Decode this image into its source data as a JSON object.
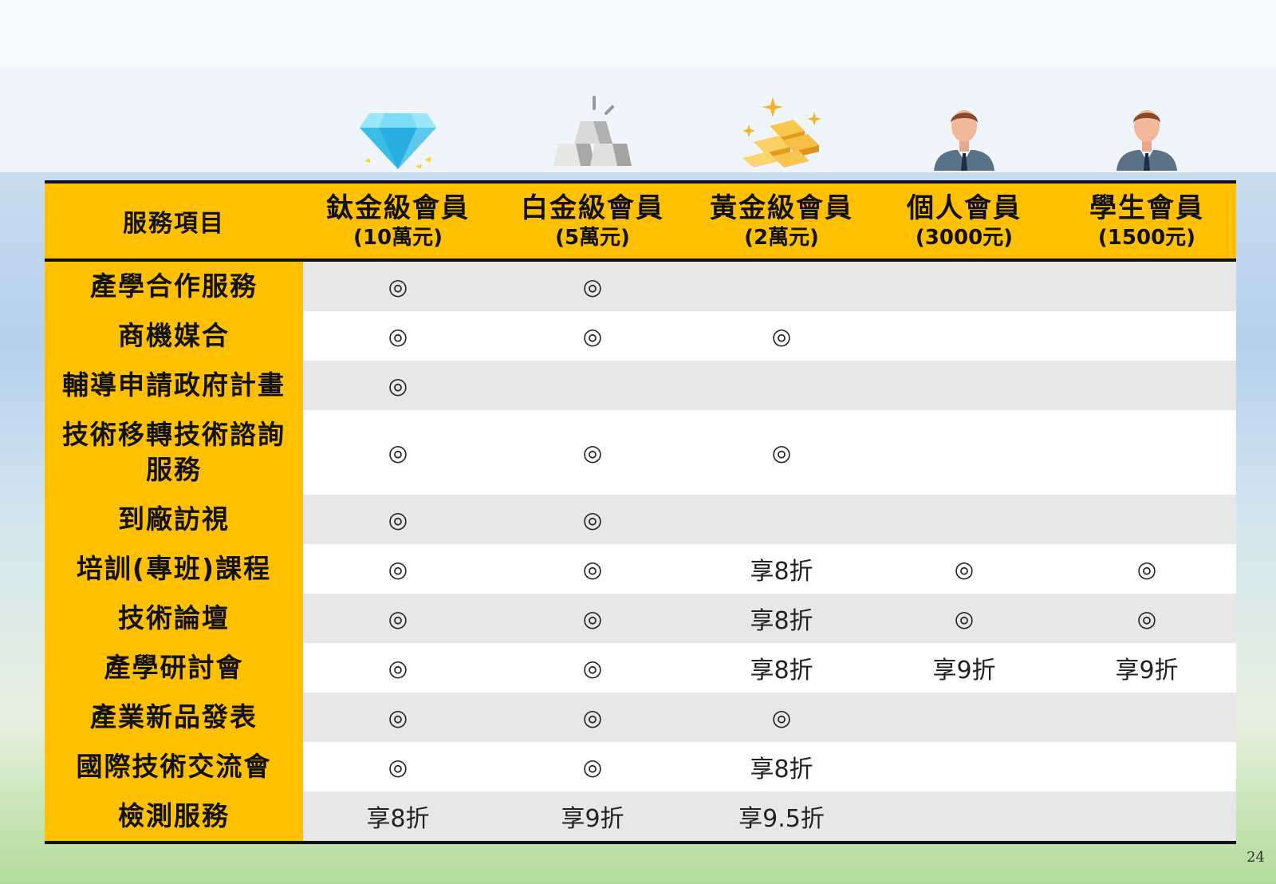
{
  "table": {
    "service_header": "服務項目",
    "tiers": [
      {
        "name": "鈦金級會員",
        "price": "(10萬元)",
        "icon": "diamond-icon"
      },
      {
        "name": "白金級會員",
        "price": "(5萬元)",
        "icon": "silver-bars-icon"
      },
      {
        "name": "黃金級會員",
        "price": "(2萬元)",
        "icon": "gold-bars-icon"
      },
      {
        "name": "個人會員",
        "price": "(3000元)",
        "icon": "person-icon"
      },
      {
        "name": "學生會員",
        "price": "(1500元)",
        "icon": "person-icon"
      }
    ],
    "rows": [
      {
        "service": "產學合作服務",
        "cells": [
          "◎",
          "◎",
          "",
          "",
          ""
        ]
      },
      {
        "service": "商機媒合",
        "cells": [
          "◎",
          "◎",
          "◎",
          "",
          ""
        ]
      },
      {
        "service": "輔導申請政府計畫",
        "cells": [
          "◎",
          "",
          "",
          "",
          ""
        ]
      },
      {
        "service": "技術移轉技術諮詢服務",
        "cells": [
          "◎",
          "◎",
          "◎",
          "",
          ""
        ]
      },
      {
        "service": "到廠訪視",
        "cells": [
          "◎",
          "◎",
          "",
          "",
          ""
        ]
      },
      {
        "service": "培訓(專班)課程",
        "cells": [
          "◎",
          "◎",
          "享8折",
          "◎",
          "◎"
        ]
      },
      {
        "service": "技術論壇",
        "cells": [
          "◎",
          "◎",
          "享8折",
          "◎",
          "◎"
        ]
      },
      {
        "service": "產學研討會",
        "cells": [
          "◎",
          "◎",
          "享8折",
          "享9折",
          "享9折"
        ]
      },
      {
        "service": "產業新品發表",
        "cells": [
          "◎",
          "◎",
          "◎",
          "",
          ""
        ]
      },
      {
        "service": "國際技術交流會",
        "cells": [
          "◎",
          "◎",
          "享8折",
          "",
          ""
        ]
      },
      {
        "service": "檢測服務",
        "cells": [
          "享8折",
          "享9折",
          "享9.5折",
          "",
          ""
        ]
      }
    ]
  },
  "colors": {
    "header": "#ffc000",
    "row_alt": "#e7e7e7",
    "row": "#ffffff",
    "border": "#111111"
  },
  "page_number": "24"
}
